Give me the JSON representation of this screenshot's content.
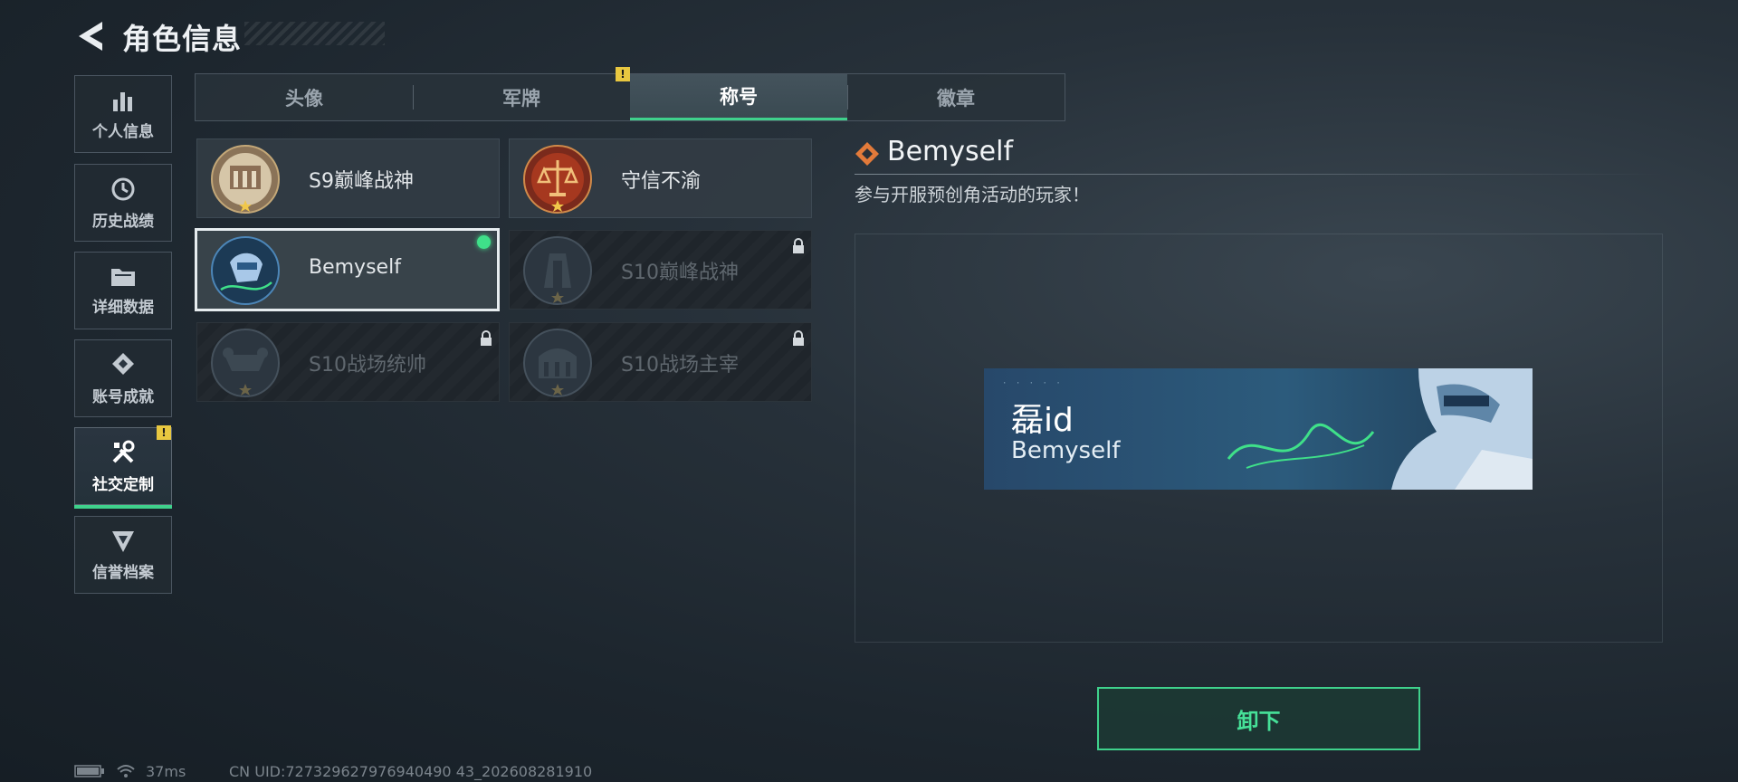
{
  "header": {
    "title": "角色信息"
  },
  "sidebar": {
    "items": [
      {
        "label": "个人信息",
        "icon": "bar-chart-icon"
      },
      {
        "label": "历史战绩",
        "icon": "history-clock-icon"
      },
      {
        "label": "详细数据",
        "icon": "folder-icon"
      },
      {
        "label": "账号成就",
        "icon": "achievement-icon"
      },
      {
        "label": "社交定制",
        "icon": "tools-icon",
        "active": true,
        "badge": "!"
      },
      {
        "label": "信誉档案",
        "icon": "reputation-icon"
      }
    ]
  },
  "tabs": [
    {
      "label": "头像"
    },
    {
      "label": "军牌",
      "badge": "!"
    },
    {
      "label": "称号",
      "active": true
    },
    {
      "label": "徽章"
    }
  ],
  "titles": [
    {
      "name": "S9巅峰战神",
      "state": "unlocked"
    },
    {
      "name": "守信不渝",
      "state": "unlocked"
    },
    {
      "name": "Bemyself",
      "state": "equipped"
    },
    {
      "name": "S10巅峰战神",
      "state": "locked"
    },
    {
      "name": "S10战场统帅",
      "state": "locked"
    },
    {
      "name": "S10战场主宰",
      "state": "locked"
    }
  ],
  "detail": {
    "title": "Bemyself",
    "description": "参与开服预创角活动的玩家！",
    "preview": {
      "player_name": "磊id",
      "title": "Bemyself"
    }
  },
  "actions": {
    "unequip_label": "卸下"
  },
  "status_bar": {
    "ping": "37ms",
    "uid": "CN UID:727329627976940490 43_202608281910"
  },
  "colors": {
    "accent": "#3fd18c",
    "warning": "#e8c740",
    "diamond": "#e27a3a"
  }
}
